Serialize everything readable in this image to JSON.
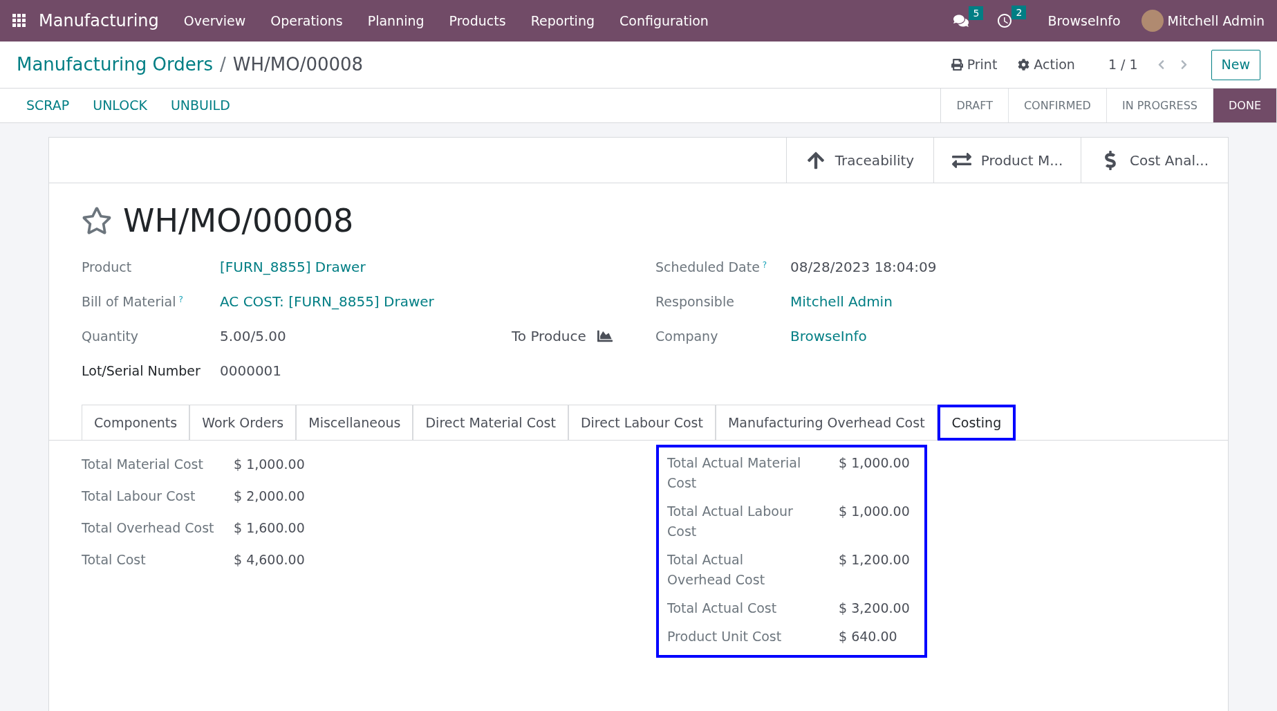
{
  "navbar": {
    "app_name": "Manufacturing",
    "menu": [
      "Overview",
      "Operations",
      "Planning",
      "Products",
      "Reporting",
      "Configuration"
    ],
    "messages_count": "5",
    "activities_count": "2",
    "company": "BrowseInfo",
    "user": "Mitchell Admin"
  },
  "breadcrumb": {
    "parent": "Manufacturing Orders",
    "separator": "/",
    "current": "WH/MO/00008"
  },
  "control_panel": {
    "print": "Print",
    "action": "Action",
    "pager": "1 / 1",
    "new": "New"
  },
  "action_buttons": [
    "SCRAP",
    "UNLOCK",
    "UNBUILD"
  ],
  "stages": [
    {
      "label": "DRAFT",
      "selected": false
    },
    {
      "label": "CONFIRMED",
      "selected": false
    },
    {
      "label": "IN PROGRESS",
      "selected": false
    },
    {
      "label": "DONE",
      "selected": true
    }
  ],
  "smart_buttons": [
    {
      "kind": "trace",
      "label": "Traceability"
    },
    {
      "kind": "moves",
      "label": "Product M..."
    },
    {
      "kind": "cost",
      "label": "Cost Anal..."
    }
  ],
  "record": {
    "starred": false,
    "name": "WH/MO/00008"
  },
  "fields_left": [
    {
      "kind": "link",
      "label": "Product",
      "strong": false,
      "value": "[FURN_8855] Drawer"
    },
    {
      "kind": "link",
      "label": "Bill of Material",
      "help": "?",
      "strong": false,
      "value": "AC COST: [FURN_8855] Drawer"
    },
    {
      "kind": "quantity",
      "label": "Quantity",
      "strong": false,
      "value": "5.00/5.00",
      "extra": "To Produce"
    },
    {
      "kind": "text",
      "label": "Lot/Serial Number",
      "strong": true,
      "value": "0000001"
    }
  ],
  "fields_right": [
    {
      "kind": "text",
      "label": "Scheduled Date",
      "help": "?",
      "value": "08/28/2023 18:04:09"
    },
    {
      "kind": "link",
      "label": "Responsible",
      "value": "Mitchell Admin"
    },
    {
      "kind": "link",
      "label": "Company",
      "value": "BrowseInfo"
    }
  ],
  "tabs": [
    {
      "label": "Components",
      "selected": false
    },
    {
      "label": "Work Orders",
      "selected": false
    },
    {
      "label": "Miscellaneous",
      "selected": false
    },
    {
      "label": "Direct Material Cost",
      "selected": false
    },
    {
      "label": "Direct Labour Cost",
      "selected": false
    },
    {
      "label": "Manufacturing Overhead Cost",
      "selected": false
    },
    {
      "label": "Costing",
      "selected": true
    }
  ],
  "costing": {
    "planned": [
      {
        "label": "Total Material Cost",
        "value": "$ 1,000.00"
      },
      {
        "label": "Total Labour Cost",
        "value": "$ 2,000.00"
      },
      {
        "label": "Total Overhead Cost",
        "value": "$ 1,600.00"
      },
      {
        "label": "Total Cost",
        "value": "$ 4,600.00"
      }
    ],
    "actual": [
      {
        "label": "Total Actual Material Cost",
        "value": "$ 1,000.00"
      },
      {
        "label": "Total Actual Labour Cost",
        "value": "$ 1,000.00"
      },
      {
        "label": "Total Actual Overhead Cost",
        "value": "$ 1,200.00"
      },
      {
        "label": "Total Actual Cost",
        "value": "$ 3,200.00"
      },
      {
        "label": "Product Unit Cost",
        "value": "$ 640.00"
      }
    ]
  }
}
